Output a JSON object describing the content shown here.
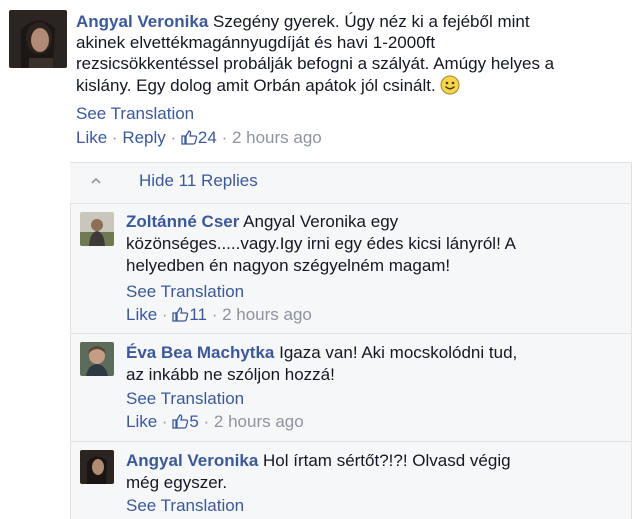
{
  "main_comment": {
    "author": "Angyal Veronika",
    "lines": [
      "Szegény gyerek. Úgy néz ki a fejéből mint",
      "akinek elvettékmagánnyugdíját és havi 1-2000ft",
      "rezsicsökkentéssel probálják befogni a szályát. Amúgy helyes a",
      "kislány. Egy dolog amit Orbán apátok jól csinált."
    ],
    "see_translation": "See Translation",
    "like": "Like",
    "reply": "Reply",
    "likes": "24",
    "time": "2 hours ago",
    "emoji": "smiley-face"
  },
  "replies": {
    "hide_label": "Hide 11 Replies",
    "items": [
      {
        "author": "Zoltánné Cser",
        "lines": [
          "Angyal Veronika egy",
          "közönséges.....vagy.Igy irni egy édes kicsi lányról! A",
          "helyedben én nagyon szégyelném magam!"
        ],
        "see_translation": "See Translation",
        "like": "Like",
        "likes": "11",
        "time": "2 hours ago"
      },
      {
        "author": "Éva Bea Machytka",
        "lines": [
          "Igaza van! Aki mocskolódni tud,",
          "az inkább ne szóljon hozzá!"
        ],
        "see_translation": "See Translation",
        "like": "Like",
        "likes": "5",
        "time": "2 hours ago"
      },
      {
        "author": "Angyal Veronika",
        "lines": [
          "Hol írtam sértőt?!?! Olvasd végig",
          "még egyszer."
        ],
        "see_translation": "See Translation"
      }
    ]
  },
  "colors": {
    "link": "#3b5998",
    "text": "#141823",
    "muted": "#8d949e",
    "reply_bg": "#f6f7f9"
  }
}
